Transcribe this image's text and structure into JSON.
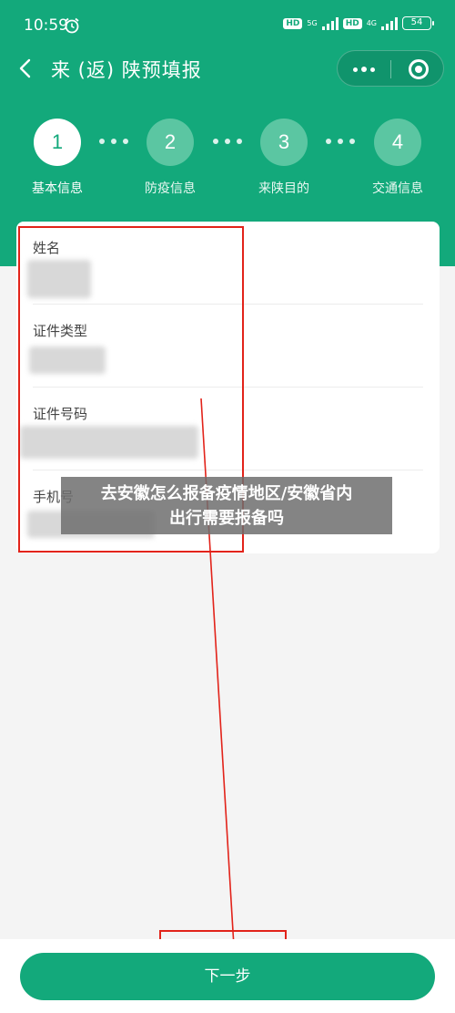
{
  "status_bar": {
    "time": "10:59",
    "hd1": "HD",
    "net1": "5G",
    "hd2": "HD",
    "net2": "4G",
    "battery": "54"
  },
  "nav": {
    "title": "来 (返) 陕预填报"
  },
  "steps": [
    {
      "number": "1",
      "label": "基本信息",
      "active": true
    },
    {
      "number": "2",
      "label": "防疫信息",
      "active": false
    },
    {
      "number": "3",
      "label": "来陕目的",
      "active": false
    },
    {
      "number": "4",
      "label": "交通信息",
      "active": false
    }
  ],
  "form": {
    "fields": [
      {
        "label": "姓名"
      },
      {
        "label": "证件类型"
      },
      {
        "label": "证件号码"
      },
      {
        "label": "手机号"
      }
    ]
  },
  "watermark": {
    "line1": "去安徽怎么报备疫情地区/安徽省内",
    "line2": "出行需要报备吗"
  },
  "footer": {
    "next_label": "下一步"
  },
  "colors": {
    "brand_green": "#13a97b",
    "annotation_red": "#e2231a"
  }
}
